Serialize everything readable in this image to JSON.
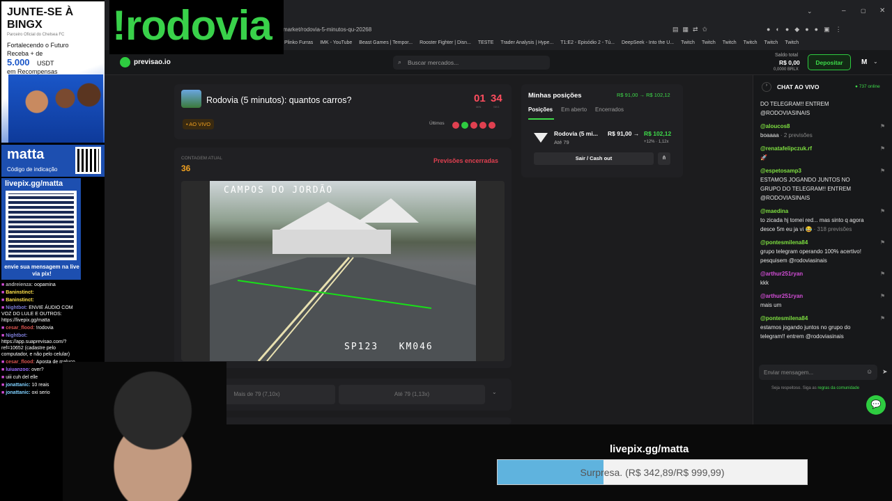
{
  "stream": {
    "logo_text": "!rodovia",
    "bingx_title": "JUNTE-SE À BINGX",
    "bingx_sub": "Parceiro Oficial do Chelsea FC",
    "bingx_line1": "Fortalecendo o Futuro",
    "bingx_line2": "Receba + de",
    "bingx_amount": "5.000",
    "bingx_currency": "USDT",
    "bingx_line3": "em Recompensas",
    "matta": "matta",
    "matta_code": "Código de indicação",
    "livepix": "livepix.gg/matta",
    "livepix_msg": "envie sua mensagem na live via pix!",
    "bottom_link": "livepix.gg/matta",
    "goal_text": "Surpresa. (R$ 342,89/R$ 999,99)",
    "goal_progress": 0.343
  },
  "twitch_chat": [
    {
      "user": "andreienza:",
      "msg": "oopamina",
      "color": "#b0b0b0"
    },
    {
      "user": "Baninstinct:",
      "msg": "",
      "color": "#ffe14a"
    },
    {
      "user": "Baninstinct:",
      "msg": "",
      "color": "#ffe14a"
    },
    {
      "user": "Nightbot:",
      "msg": "ENVIE ÁUDIO COM VOZ DO LULE E OUTROS: https://livepix.gg/matta",
      "color": "#7b7bd6"
    },
    {
      "user": "cesar_flood:",
      "msg": "!rodovia",
      "color": "#d9534f"
    },
    {
      "user": "Nightbot:",
      "msg": "https://app.suaprevisao.com/?ref=10652 (cadastre pelo computador, e não pelo celular)",
      "color": "#7b7bd6"
    },
    {
      "user": "cesar_flood:",
      "msg": "Aposta de maluco",
      "color": "#d9534f"
    },
    {
      "user": "luiuanzoo:",
      "msg": "over?",
      "color": "#9a6cff"
    },
    {
      "user": "",
      "msg": "uiii cuh del elle",
      "color": "#3ab0ff"
    },
    {
      "user": "jonattanic:",
      "msg": "10 reais",
      "color": "#7fd0ff"
    },
    {
      "user": "jonattanic:",
      "msg": "oxi serio",
      "color": "#7fd0ff"
    }
  ],
  "browser": {
    "url": "market/rodovia-5-minutos-qu-20268",
    "bookmarks": [
      "Plinko Furras",
      "IMK - YouTube",
      "Beast Games | Tempor...",
      "Rooster Fighter | Disn...",
      "TESTE",
      "Trader Analysis | Hype...",
      "T1:E2 - Episódio 2 - Tú...",
      "DeepSeek - Into the U...",
      "Twitch",
      "Twitch",
      "Twitch",
      "Twitch",
      "Twitch",
      "Twitch"
    ]
  },
  "site": {
    "brand": "previsao.io",
    "search_placeholder": "Buscar mercados...",
    "saldo_label": "Saldo total",
    "saldo_value": "R$ 0,00",
    "saldo_sub": "0,0000 BRLX",
    "deposit": "Depositar",
    "user_initial": "M"
  },
  "market": {
    "title": "Rodovia (5 minutos): quantos carros?",
    "live_badge": "• AO VIVO",
    "timer_min": "01",
    "timer_sec": "34",
    "timer_min_label": "MIN",
    "timer_sec_label": "SEG",
    "ultimos": "Últimos",
    "count_label": "CONTAGEM ATUAL",
    "count_value": "36",
    "closed": "Previsões encerradas",
    "cam_top": "CAMPOS DO JORDÃO",
    "cam_bottom": "SP123   KM046",
    "option1": "Mais de 79 (7,10x)",
    "option2": "Até 79 (1,13x)"
  },
  "positions": {
    "title": "Minhas posições",
    "change": "R$ 91,00 → R$ 102,12",
    "tabs": [
      "Posições",
      "Em aberto",
      "Encerrados"
    ],
    "item_name": "Rodovia (5 mi...",
    "item_sub": "Até 79",
    "item_value": "R$ 91,00 →",
    "item_new": "R$ 102,12",
    "item_pct": "+12% · 1,12x",
    "cashout": "Sair / Cash out"
  },
  "chat": {
    "title": "CHAT AO VIVO",
    "online": "● 737 online",
    "messages": [
      {
        "user": "",
        "text": "DO TELEGRAM!! ENTREM @RODOVIASINAIS",
        "meta": "",
        "ucolor": "#7ee040"
      },
      {
        "user": "@aloucos8",
        "text": "boaaaa",
        "meta": " · 2 previsões",
        "ucolor": "#7ee040"
      },
      {
        "user": "@renatafelipczuk.rf",
        "text": "🚀",
        "meta": "",
        "ucolor": "#7ee040"
      },
      {
        "user": "@espetosamp3",
        "text": "ESTAMOS JOGANDO JUNTOS NO GRUPO DO TELEGRAM!! ENTREM @RODOVIASINAIS",
        "meta": "",
        "ucolor": "#7ee040"
      },
      {
        "user": "@maedina",
        "text": "to zicada hj tomei red... mas sinto q agora desce 5m eu ja vi 😂",
        "meta": " · 318 previsões",
        "ucolor": "#7ee040"
      },
      {
        "user": "@pontesmilena84",
        "text": "grupo telegram operando 100% acertivo! pesquisem @rodoviasinais",
        "meta": "",
        "ucolor": "#7ee040"
      },
      {
        "user": "@arthur251ryan",
        "text": "kkk",
        "meta": "",
        "ucolor": "#d24dd6"
      },
      {
        "user": "@arthur251ryan",
        "text": "mais um",
        "meta": "",
        "ucolor": "#d24dd6"
      },
      {
        "user": "@pontesmilena84",
        "text": "estamos jogando juntos no grupo do telegram!! entrem @rodoviasinais",
        "meta": "",
        "ucolor": "#7ee040"
      }
    ],
    "input_placeholder": "Enviar mensagem...",
    "rules": "Seja respeitoso. Siga as ",
    "rules_link": "regras da comunidade"
  }
}
